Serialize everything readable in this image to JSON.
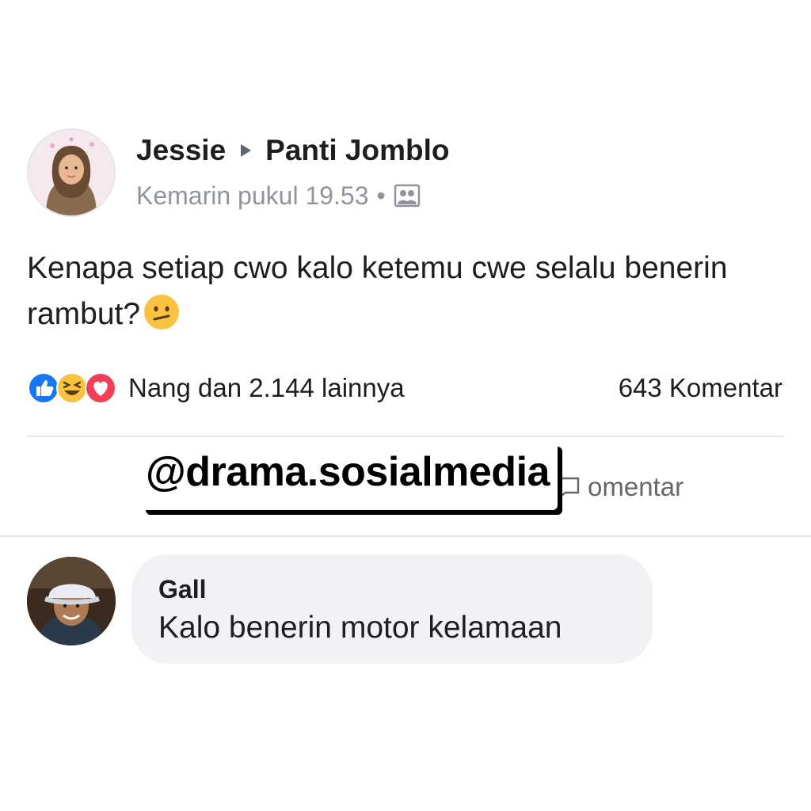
{
  "post": {
    "author": "Jessie",
    "group": "Panti Jomblo",
    "timestamp": "Kemarin pukul 19.53",
    "separator": "•",
    "privacy_icon": "group-icon",
    "text": "Kenapa setiap cwo kalo ketemu cwe selalu benerin rambut?",
    "emoji": "confused-face-icon"
  },
  "reactions": {
    "icons": [
      "like-icon",
      "laugh-icon",
      "love-icon"
    ],
    "summary": "Nang dan 2.144 lainnya",
    "comment_count": "643 Komentar"
  },
  "actions": {
    "comment_label_visible": "omentar"
  },
  "watermark": {
    "text": "@drama.sosialmedia"
  },
  "comment": {
    "author": "Gall",
    "text": "Kalo benerin motor kelamaan"
  },
  "colors": {
    "like_blue": "#1877f2",
    "love_red": "#f33e58",
    "laugh_yellow": "#f7c340",
    "meta_gray": "#90949c",
    "bubble_bg": "#f0f2f5"
  }
}
